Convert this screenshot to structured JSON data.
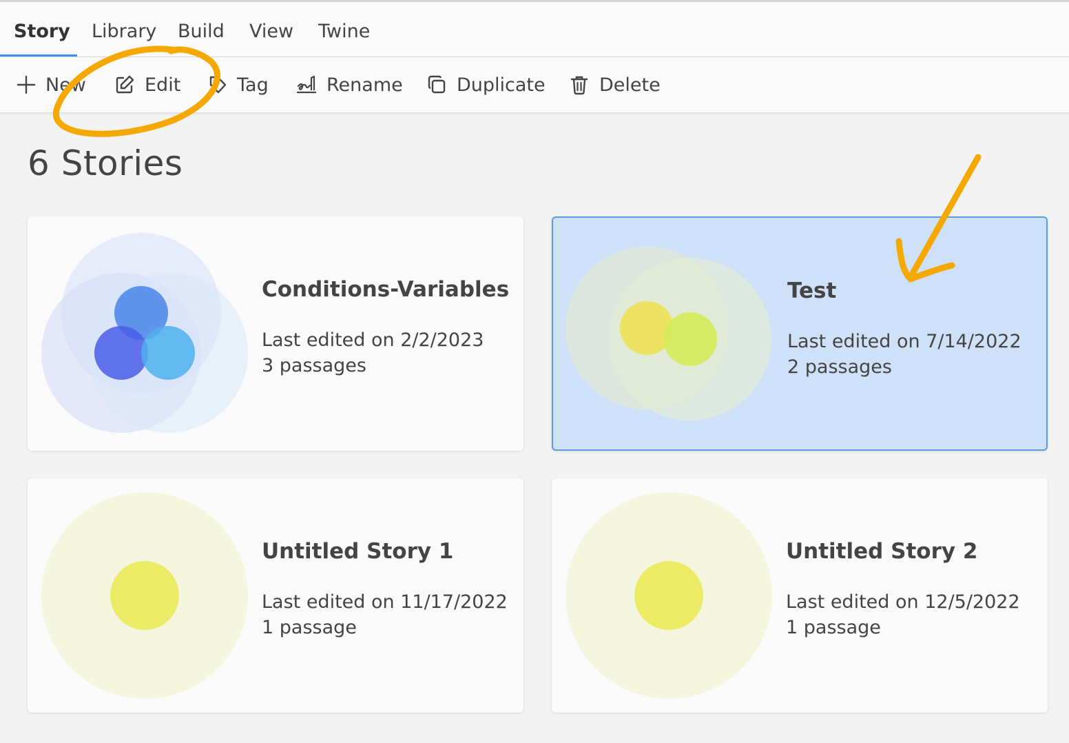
{
  "tabs": [
    "Story",
    "Library",
    "Build",
    "View",
    "Twine"
  ],
  "toolbar": {
    "new": "New",
    "edit": "Edit",
    "tag": "Tag",
    "rename": "Rename",
    "duplicate": "Duplicate",
    "delete": "Delete"
  },
  "heading": "6 Stories",
  "stories": [
    {
      "title": "Conditions-Variables",
      "edited": "Last edited on 2/2/2023",
      "passages": "3 passages"
    },
    {
      "title": "Test",
      "edited": "Last edited on 7/14/2022",
      "passages": "2 passages"
    },
    {
      "title": "Untitled Story 1",
      "edited": "Last edited on 11/17/2022",
      "passages": "1 passage"
    },
    {
      "title": "Untitled Story 2",
      "edited": "Last edited on 12/5/2022",
      "passages": "1 passage"
    }
  ],
  "colors": {
    "accent": "#3c8ee6",
    "selected_card": "#cfe1f8",
    "annotation": "#f5a800"
  }
}
